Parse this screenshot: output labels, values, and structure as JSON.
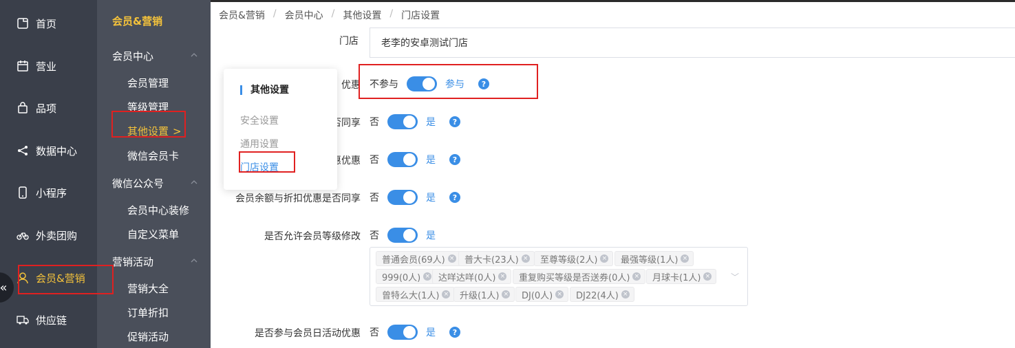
{
  "primary_nav": [
    {
      "label": "首页",
      "icon": "home-icon"
    },
    {
      "label": "营业",
      "icon": "calendar-icon"
    },
    {
      "label": "品项",
      "icon": "bag-icon"
    },
    {
      "label": "数据中心",
      "icon": "share-icon"
    },
    {
      "label": "小程序",
      "icon": "phone-icon"
    },
    {
      "label": "外卖团购",
      "icon": "bike-icon"
    },
    {
      "label": "会员&营销",
      "icon": "user-icon",
      "active": true
    },
    {
      "label": "供应链",
      "icon": "truck-icon"
    }
  ],
  "collapse_glyph": "«",
  "secondary_nav": {
    "title": "会员&营销",
    "groups": [
      {
        "label": "会员中心",
        "items": [
          "会员管理",
          "等级管理",
          "其他设置",
          "微信会员卡"
        ]
      },
      {
        "label": "微信公众号",
        "items": [
          "会员中心装修",
          "自定义菜单"
        ]
      },
      {
        "label": "营销活动",
        "items": [
          "营销大全",
          "订单折扣",
          "促销活动"
        ]
      }
    ],
    "active_item": "其他设置",
    "active_chevron": ">"
  },
  "breadcrumb": [
    "会员&营销",
    "会员中心",
    "其他设置",
    "门店设置"
  ],
  "breadcrumb_sep": "/",
  "popup": {
    "title": "其他设置",
    "items": [
      "安全设置",
      "通用设置",
      "门店设置"
    ],
    "active": "门店设置"
  },
  "form": {
    "store_label": "门店",
    "store_value": "老李的安卓测试门店",
    "rows": [
      {
        "label": "优惠",
        "off": "不参与",
        "on": "参与",
        "value": true,
        "help": true
      },
      {
        "label": "否同享",
        "off": "否",
        "on": "是",
        "value": true,
        "help": true
      },
      {
        "label": "惠优惠",
        "off": "否",
        "on": "是",
        "value": true,
        "help": true
      },
      {
        "label": "会员余额与折扣优惠是否同享",
        "off": "否",
        "on": "是",
        "value": true,
        "help": true
      },
      {
        "label": "是否允许会员等级修改",
        "off": "否",
        "on": "是",
        "value": true,
        "help": false
      },
      {
        "label": "是否参与会员日活动优惠",
        "off": "否",
        "on": "是",
        "value": true,
        "help": true
      }
    ],
    "help_glyph": "?",
    "levels": [
      "普通会员(69人)",
      "普大卡(23人)",
      "至尊等级(2人)",
      "最强等级(1人)",
      "999(0人)",
      "达咩达咩(0人)",
      "重复购买等级是否送券(0人)",
      "月球卡(1人)",
      "曾特么大(1人)",
      "升级(1人)",
      "DJ(0人)",
      "DJ22(4人)"
    ],
    "tag_close_glyph": "×",
    "tagbox_chevron": "﹀"
  },
  "colors": {
    "primary_nav_bg": "#3a3f4a",
    "secondary_nav_bg": "#4a4f5a",
    "accent": "#f5c33b",
    "switch_on": "#3a8ee6",
    "highlight": "#e02020"
  }
}
